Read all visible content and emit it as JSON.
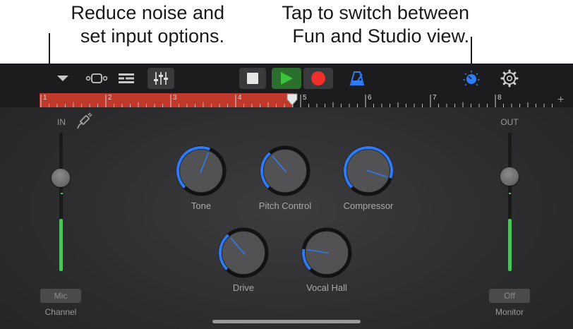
{
  "callouts": {
    "left": [
      "Reduce noise and",
      "set input options."
    ],
    "right": [
      "Tap to switch between",
      "Fun and Studio view."
    ]
  },
  "toolbar": {
    "tracks_menu_icon": "chevron-down-icon",
    "view_toggle_icon": "instrument-view-icon",
    "tracks_view_icon": "tracks-view-icon",
    "mixer_icon": "mixer-sliders-icon",
    "stop_icon": "stop-icon",
    "play_icon": "play-icon",
    "record_icon": "record-icon",
    "metronome_icon": "metronome-icon",
    "fun_studio_icon": "studio-knob-icon",
    "settings_icon": "gear-icon",
    "accent": "#2f7bf5",
    "play_color": "#3cc43c",
    "record_color": "#f0302a"
  },
  "ruler": {
    "bars": [
      "1",
      "2",
      "3",
      "4",
      "5",
      "6",
      "7",
      "8"
    ],
    "add_label": "+",
    "played_color": "#c0392b"
  },
  "input": {
    "label": "IN",
    "icon": "input-cable-icon",
    "level": 0.38,
    "channel_button": "Mic",
    "channel_label": "Channel"
  },
  "output": {
    "label": "OUT",
    "level": 0.38,
    "monitor_button": "Off",
    "monitor_label": "Monitor"
  },
  "knobs": [
    {
      "label": "Tone",
      "value": 0.58
    },
    {
      "label": "Pitch Control",
      "value": 0.35
    },
    {
      "label": "Compressor",
      "value": 0.9
    },
    {
      "label": "Drive",
      "value": 0.35
    },
    {
      "label": "Vocal Hall",
      "value": 0.2
    }
  ]
}
